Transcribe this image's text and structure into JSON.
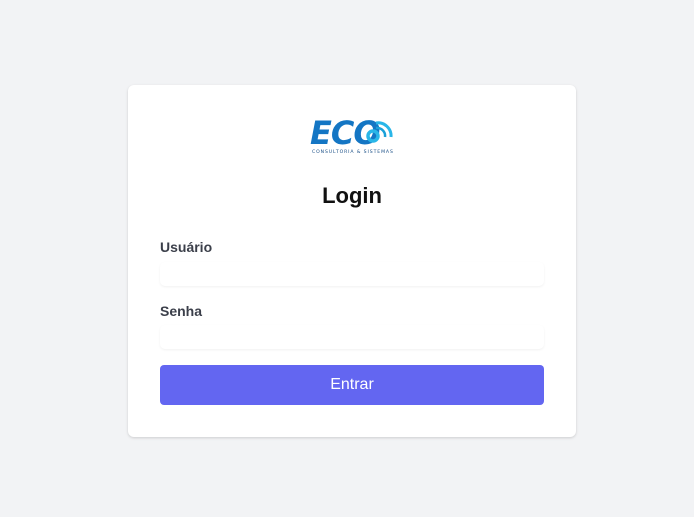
{
  "logo": {
    "main_text": "ECO",
    "tagline": "CONSULTORIA & SISTEMAS"
  },
  "form": {
    "title": "Login",
    "username_label": "Usuário",
    "username_value": "",
    "password_label": "Senha",
    "password_value": "",
    "submit_label": "Entrar"
  },
  "colors": {
    "background": "#f2f3f5",
    "card": "#ffffff",
    "accent": "#6366f1",
    "logo_blue": "#1476c4",
    "logo_cyan": "#29b6e8"
  }
}
